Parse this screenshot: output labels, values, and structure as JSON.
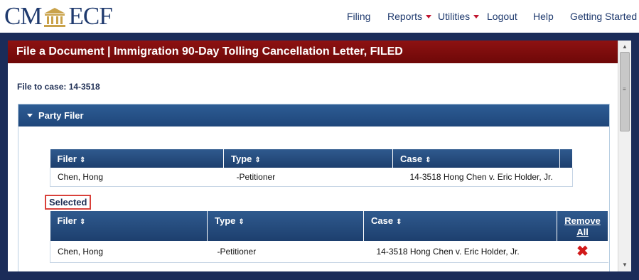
{
  "logo": {
    "left": "CM",
    "right": "ECF"
  },
  "nav": {
    "filing": "Filing",
    "reports": "Reports",
    "utilities": "Utilities",
    "logout": "Logout",
    "help": "Help",
    "getting_started": "Getting Started"
  },
  "page": {
    "title": "File a Document | Immigration 90-Day Tolling Cancellation Letter, FILED",
    "case_label": "File to case: 14-3518"
  },
  "party_panel": {
    "title": "Party Filer",
    "available": {
      "columns": [
        "Filer",
        "Type",
        "Case"
      ],
      "rows": [
        {
          "filer": "Chen, Hong",
          "type": "-Petitioner",
          "case": "14-3518 Hong Chen v. Eric Holder, Jr."
        }
      ]
    },
    "selected_label": "Selected",
    "selected": {
      "columns": [
        "Filer",
        "Type",
        "Case"
      ],
      "remove_all_line1": "Remove",
      "remove_all_line2": "All",
      "rows": [
        {
          "filer": "Chen, Hong",
          "type": "-Petitioner",
          "case": "14-3518 Hong Chen v. Eric Holder, Jr."
        }
      ]
    }
  },
  "icons": {
    "sort": "sort-updown-icon",
    "remove": "red-x-icon",
    "expand": "triangle-down-icon"
  },
  "colors": {
    "title_bar": "#7d0d0d",
    "frame": "#1b2c59",
    "table_header": "#264c80",
    "selected_border": "#d9403a",
    "remove_icon": "#d11a1a"
  }
}
